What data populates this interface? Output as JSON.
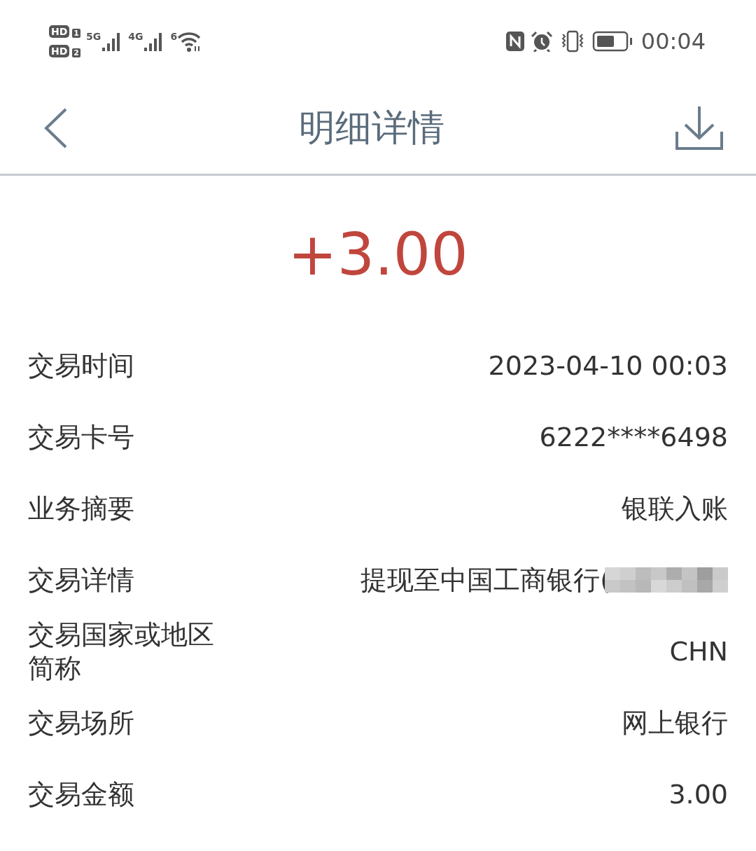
{
  "status_bar": {
    "sim_labels": [
      "HD",
      "HD"
    ],
    "sim_numbers": [
      "1",
      "2"
    ],
    "networks": [
      "5G",
      "4G"
    ],
    "wifi_label": "6",
    "time": "00:04"
  },
  "header": {
    "title": "明细详情"
  },
  "amount": "+3.00",
  "details": [
    {
      "label": "交易时间",
      "value": "2023-04-10 00:03"
    },
    {
      "label": "交易卡号",
      "value": "6222****6498"
    },
    {
      "label": "业务摘要",
      "value": "银联入账"
    },
    {
      "label": "交易详情",
      "value": "提现至中国工商银行(",
      "redacted": true
    },
    {
      "label": "交易国家或地区简称",
      "value": "CHN"
    },
    {
      "label": "交易场所",
      "value": "网上银行"
    },
    {
      "label": "交易金额",
      "value": "3.00"
    }
  ]
}
